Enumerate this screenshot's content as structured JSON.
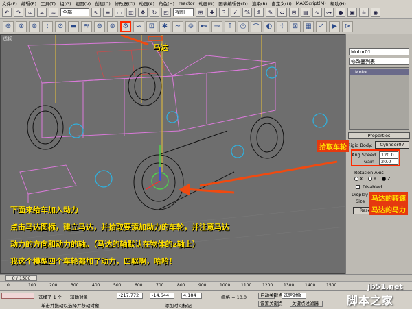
{
  "menu": [
    "文件(F)",
    "编辑(E)",
    "工具(T)",
    "组(G)",
    "视图(V)",
    "创建(C)",
    "修改器(O)",
    "动画(A)",
    "角色(H)",
    "reactor",
    "动画(N)",
    "图表编辑器(D)",
    "渲染(R)",
    "自定义(U)",
    "MAXScript(M)",
    "帮助(H)"
  ],
  "toolbar1": {
    "selection_filter": "全部",
    "view_select": "视图"
  },
  "viewport": {
    "label": "透视"
  },
  "annotations": {
    "motor_label": "马达",
    "pick_wheel": "拾取车轮",
    "motor_speed": "马达的转速",
    "motor_power": "马达的马力",
    "line1": "下面来给车加入动力",
    "line2": "点击马达图标，建立马达，并拾取要添加动力的车轮，并注意马达",
    "line3": "动力的方向和动力的轴。（马达的轴默认在物体的z轴上）",
    "line4": "我这个模型四个车轮都加了动力，四驱啊，哈哈！"
  },
  "command_panel": {
    "object_name": "Motor01",
    "modifier_list": "修改器列表",
    "stack_item": "Motor",
    "rollout_properties": "Properties",
    "rigid_body_label": "Rigid Body:",
    "rigid_body_value": "Cylinder07",
    "ang_speed_label": "Ang Speed",
    "ang_speed_value": "120.0",
    "gain_label": "Gain",
    "gain_value": "20.0",
    "rotation_axis": "Rotation Axis",
    "axis_x": "X",
    "axis_y": "Y",
    "axis_z": "Z",
    "disabled": "Disabled",
    "display": "Display",
    "size_label": "Size",
    "reset_button": "Reset P"
  },
  "timeline": {
    "frame": "0 / 1500",
    "ticks": [
      "0",
      "100",
      "200",
      "300",
      "400",
      "500",
      "600",
      "700",
      "800",
      "900",
      "1000",
      "1100",
      "1200",
      "1300",
      "1400",
      "1500"
    ]
  },
  "status": {
    "selected": "选择了 1 个",
    "helper": "辅助对象",
    "x_value": "-217.772",
    "y_value": "-14.644",
    "z_value": "4.184",
    "grid": "栅格 = 10.0",
    "auto_key": "自动关键点",
    "set_key": "设置关键点",
    "selected_obj": "选定对象",
    "key_filter": "关键点过滤器",
    "hint": "单击并拖动以选择并移动对象",
    "add_time_tag": "添加时间标记"
  },
  "watermark": {
    "site": "jb51.net",
    "name": "脚本之家"
  },
  "colors": {
    "annotation_yellow": "#ffe000",
    "annotation_red": "#e5390f",
    "viewport_bg": "#6e6e6e"
  }
}
